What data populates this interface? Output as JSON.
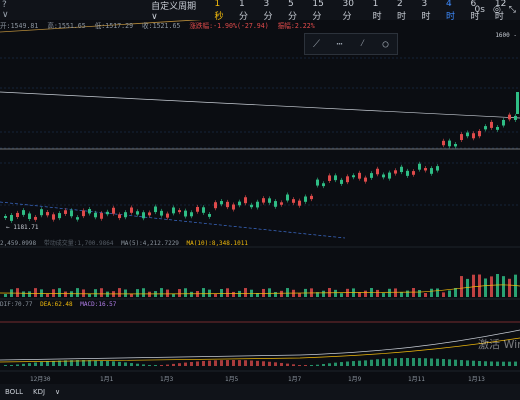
{
  "topbar": {
    "symbol": "? ∨",
    "nav": [
      "自定义周期 ∨",
      "1秒",
      "1分",
      "3分",
      "5分",
      "15分",
      "30分",
      "1时",
      "2时",
      "3时",
      "4时",
      "6时",
      "12时"
    ],
    "active_index": 1,
    "selected_index": 10,
    "right": [
      "0s",
      "◎",
      "⤡"
    ]
  },
  "ohlc": {
    "open": "开:1549.81",
    "high": "高:1551.65",
    "low": "低:1517.29",
    "close": "收:1521.65",
    "change": "涨跌幅:-1.90%(-27.94)",
    "amplitude": "振幅:2.22%"
  },
  "price_tag": "1600 -",
  "low_marker": "← 1181.71",
  "volume_legend": {
    "vol": "2,459.0998",
    "hint": "带动成交量:1,700.9864",
    "ma5": "MA(5):4,212.7229",
    "ma10": "MA(10):8,348.1011"
  },
  "macd_legend": {
    "dif": "DIF:70.77",
    "dea": "DEA:62.48",
    "macd": "MACD:16.57"
  },
  "xaxis": [
    "12月30",
    "1月1",
    "1月3",
    "1月5",
    "1月7",
    "1月9",
    "1月11",
    "1月13"
  ],
  "bottombar": [
    "BOLL",
    "KDJ",
    "∨"
  ],
  "watermark": "激活 Win",
  "colors": {
    "up": "#2fbd85",
    "down": "#e04b4b",
    "accent": "#f0b90b",
    "selected": "#3e8bff",
    "background": "#0b0d12"
  },
  "toolbox_icons": [
    "trend-line-icon",
    "ray-line-icon",
    "extended-line-icon",
    "circle-icon"
  ]
}
